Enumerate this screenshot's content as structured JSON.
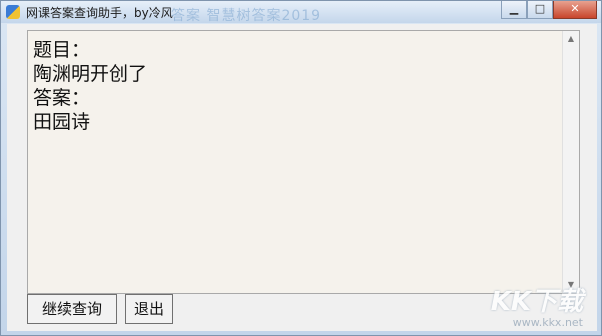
{
  "window": {
    "title": "网课答案查询助手，by冷风",
    "background_title_text": "答案 智慧树答案2019",
    "controls": [
      "minimize",
      "maximize",
      "close"
    ]
  },
  "content": {
    "text": "题目：\n陶渊明开创了\n答案：\n田园诗"
  },
  "buttons": {
    "continue_label": "继续查询",
    "exit_label": "退出"
  },
  "watermark": {
    "logo": "KK下载",
    "url": "www.kkx.net"
  }
}
